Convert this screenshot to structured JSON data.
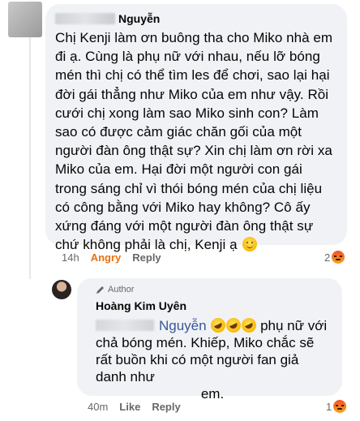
{
  "comment": {
    "author": "Nguyễn",
    "text": "Chị Kenji làm ơn buông tha cho Miko nhà em đi ạ. Cùng là phụ nữ với nhau, nếu lỡ bóng mén thì chị có thể tìm les để chơi, sao lại hại đời gái thẳng như Miko của em như vậy. Rồi cưới chị xong làm sao Miko sinh con? Làm sao có được cảm giác chăn gối của một người đàn ông thật sự? Xin chị làm ơn rời xa Miko của em. Hại đời một người con gái trong sáng chỉ vì thói bóng mén của chị liệu có công bằng với Miko hay không? Cô ấy xứng đáng với một người đàn ông thật sự chứ không phải là chị, Kenji ạ",
    "time": "14h",
    "reaction_label": "Angry",
    "reply_label": "Reply",
    "reaction_count": "2",
    "emoji": "slightly-smiling-face",
    "colors": {
      "reaction": "#e9710f",
      "meta": "#65676b",
      "bubble": "#f0f2f5"
    }
  },
  "reply": {
    "badge": "Author",
    "author": "Hoàng Kim Uyên",
    "mention": "Nguyễn",
    "text_after_mention": "phụ nữ với chả bóng mén. Khiếp, Miko chắc sẽ rất buồn khi có một người fan giả danh như",
    "text_last": "em.",
    "time": "40m",
    "like_label": "Like",
    "reply_label": "Reply",
    "reaction_count": "1",
    "emoji": "rolling-on-the-floor-laughing",
    "colors": {
      "mention": "#385898"
    }
  }
}
